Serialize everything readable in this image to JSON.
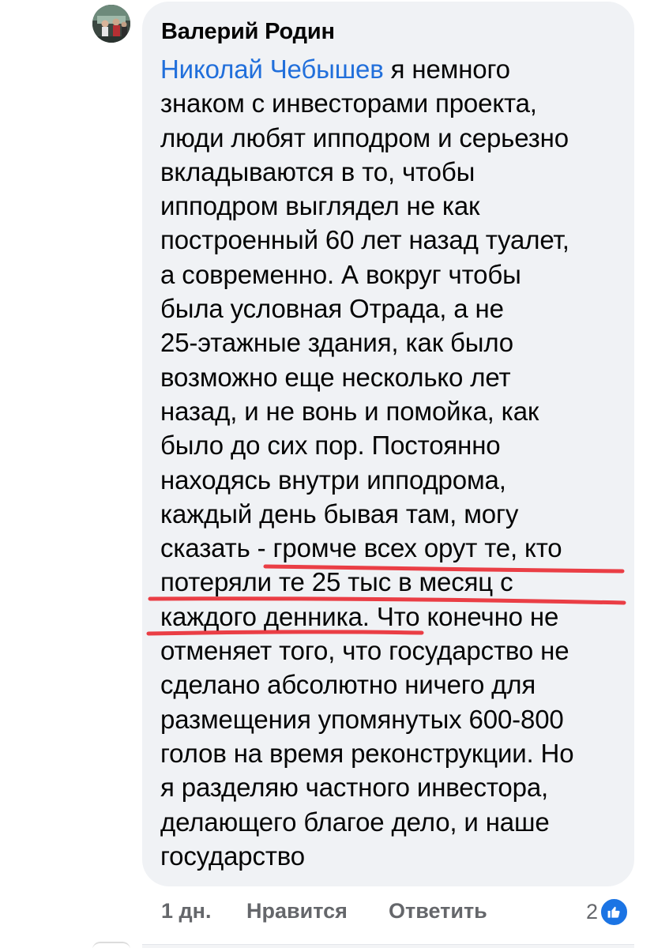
{
  "comment": {
    "author": "Валерий Родин",
    "mention": "Николай Чебышев",
    "text_lines": [
      " я немного",
      "знаком с инвесторами проекта,",
      "люди любят ипподром и серьезно",
      "вкладываются в то, чтобы",
      "ипподром выглядел не как",
      "построенный 60 лет назад туалет,",
      "а современно. А вокруг чтобы",
      "была условная Отрада, а не",
      "25-этажные здания, как было",
      "возможно еще несколько лет",
      "назад, и не вонь и помойка, как",
      "было до сих пор. Постоянно",
      "находясь внутри ипподрома,",
      "каждый день бывая там, могу",
      "сказать - громче всех орут те, кто",
      "потеряли те 25 тыс в месяц с",
      "каждого денника. Что конечно не",
      "отменяет того, что государство не",
      "сделано абсолютно ничего для",
      "размещения упомянутых 600-800",
      "голов на время реконструкции. Но",
      "я разделяю частного инвестора,",
      "делающего благое дело, и наше",
      "государство"
    ],
    "time": "1 дн.",
    "like_label": "Нравится",
    "reply_label": "Ответить",
    "reaction_count": "2",
    "reaction_icon": "thumbs-up-icon"
  },
  "colors": {
    "mention": "#216fdb",
    "bubble": "#f0f2f5",
    "secondary_text": "#65676b",
    "annotation_underline": "#e8242c",
    "like_badge": "#1b74e4"
  }
}
